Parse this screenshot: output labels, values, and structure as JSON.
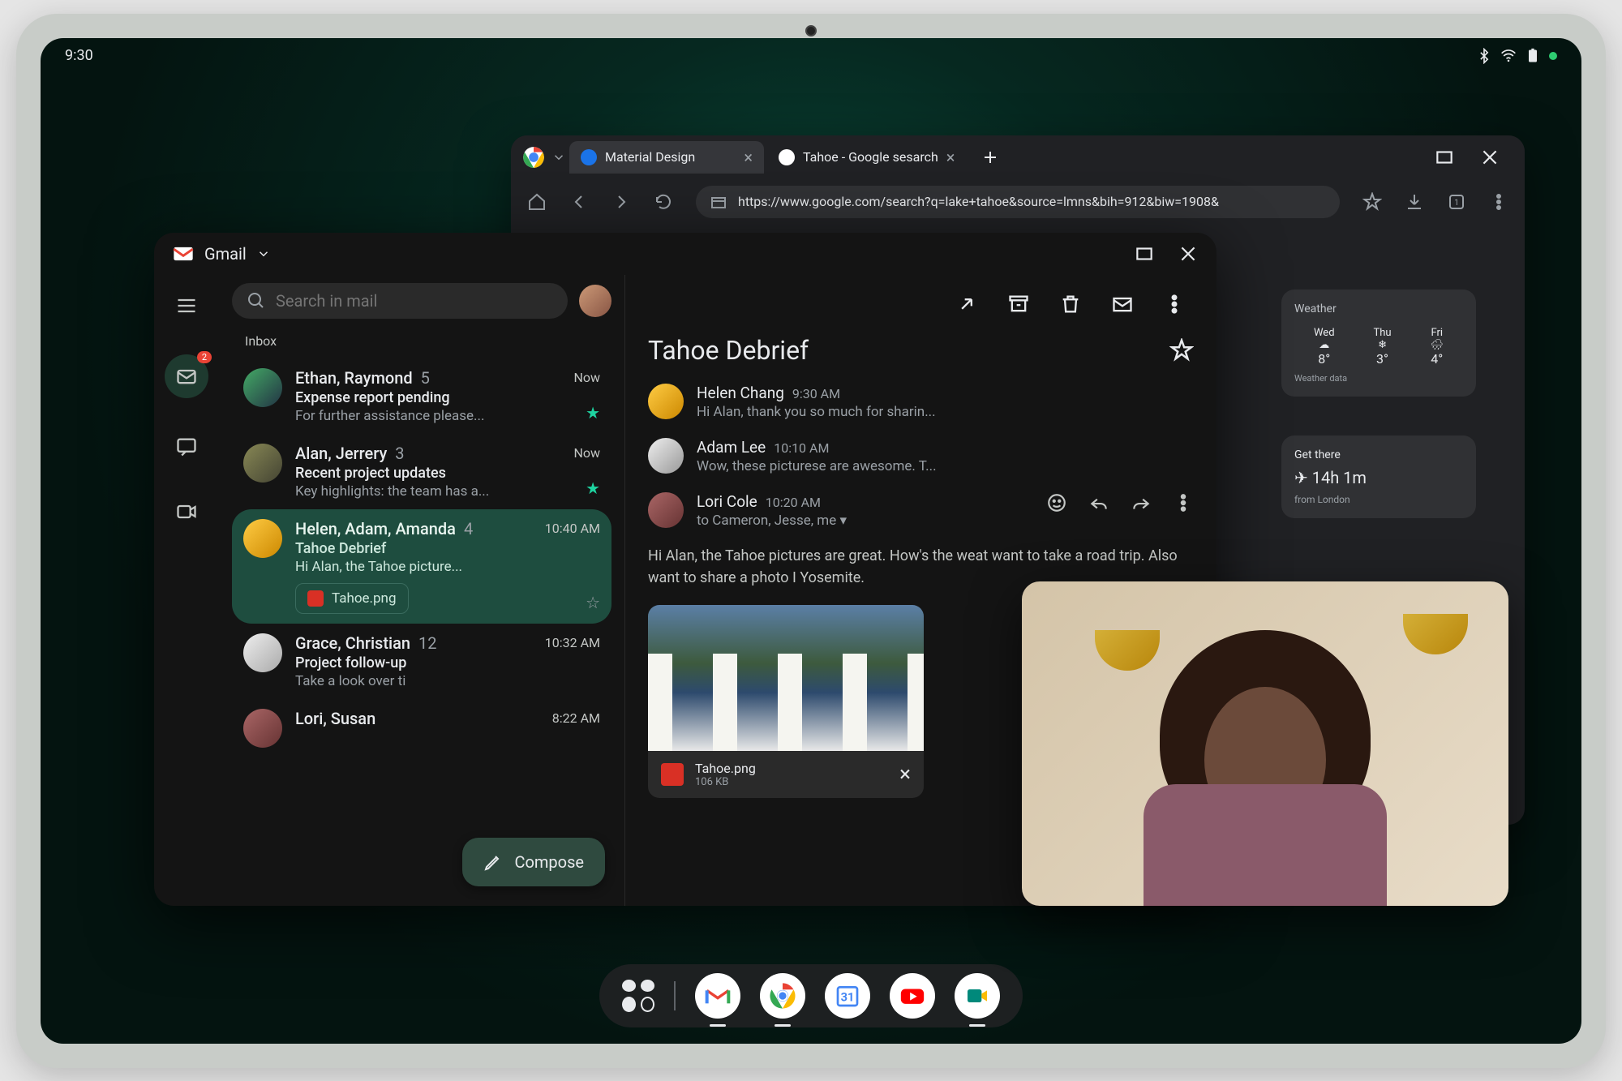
{
  "status": {
    "time": "9:30"
  },
  "chrome": {
    "tabs": [
      {
        "title": "Material Design"
      },
      {
        "title": "Tahoe - Google sesarch"
      }
    ],
    "url": "https://www.google.com/search?q=lake+tahoe&source=lmns&bih=912&biw=1908&",
    "weather": {
      "title": "Weather",
      "days": [
        {
          "label": "Wed",
          "temp": "8°",
          "icon": "☁"
        },
        {
          "label": "Thu",
          "temp": "3°",
          "icon": "❄"
        },
        {
          "label": "Fri",
          "temp": "4°",
          "icon": "🌧"
        }
      ],
      "footer": "Weather data"
    },
    "get_there": {
      "title": "Get there",
      "duration": "✈ 14h 1m",
      "from": "from London"
    }
  },
  "gmail": {
    "title": "Gmail",
    "search_placeholder": "Search in mail",
    "inbox_label": "Inbox",
    "rail_badge": "2",
    "compose": "Compose",
    "emails": [
      {
        "sender": "Ethan, Raymond",
        "count": "5",
        "time": "Now",
        "subject": "Expense report pending",
        "preview": "For further assistance please...",
        "starred": true
      },
      {
        "sender": "Alan, Jerrery",
        "count": "3",
        "time": "Now",
        "subject": "Recent project updates",
        "preview": "Key highlights: the team has a...",
        "starred": true
      },
      {
        "sender": "Helen, Adam, Amanda",
        "count": "4",
        "time": "10:40 AM",
        "subject": "Tahoe Debrief",
        "preview": "Hi Alan, the Tahoe picture...",
        "attachment": "Tahoe.png",
        "selected": true
      },
      {
        "sender": "Grace, Christian",
        "count": "12",
        "time": "10:32 AM",
        "subject": "Project follow-up",
        "preview": "Take a look over ti"
      },
      {
        "sender": "Lori, Susan",
        "count": "",
        "time": "8:22 AM",
        "subject": "",
        "preview": ""
      }
    ],
    "reader": {
      "title": "Tahoe Debrief",
      "messages": [
        {
          "name": "Helen Chang",
          "time": "9:30 AM",
          "preview": "Hi Alan, thank you so much for sharin..."
        },
        {
          "name": "Adam Lee",
          "time": "10:10 AM",
          "preview": "Wow, these picturese are awesome. T..."
        },
        {
          "name": "Lori Cole",
          "time": "10:20 AM",
          "recipients": "to Cameron, Jesse, me"
        }
      ],
      "body": "Hi Alan, the Tahoe pictures are great. How's the weat want to take a road trip. Also want to share a photo I Yosemite.",
      "attachment": {
        "name": "Tahoe.png",
        "size": "106 KB"
      }
    }
  }
}
